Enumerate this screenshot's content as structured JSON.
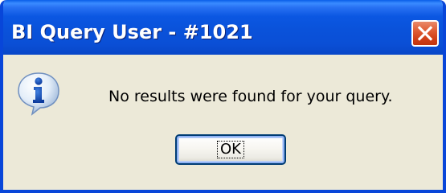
{
  "window": {
    "title": "BI Query User - #1021"
  },
  "dialog": {
    "message": "No results were found for your query.",
    "icon": "information-icon",
    "ok_label": "OK"
  },
  "colors": {
    "titlebar_blue": "#0a52da",
    "frame_blue": "#0846d9",
    "close_red": "#df5b33",
    "dialog_background": "#ece9d8",
    "button_border": "#003c74"
  }
}
